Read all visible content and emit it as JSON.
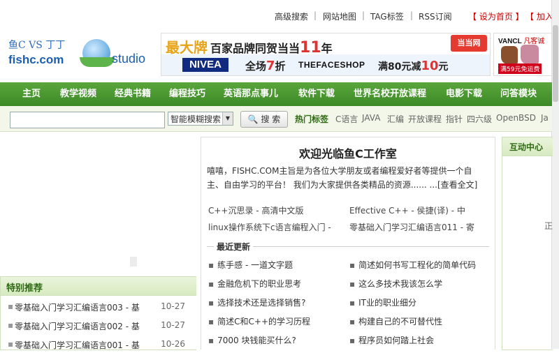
{
  "top_links": {
    "advanced_search": "高级搜索",
    "site_map": "网站地图",
    "tag": "TAG标签",
    "rss": "RSS订阅",
    "sep": "|",
    "set_home": "【 设为首页 】",
    "add_fav": "【 加入"
  },
  "logo": {
    "fish_text": "鱼C VS 丁丁",
    "domain": "fishc.com",
    "studio": "studio"
  },
  "banner": {
    "brand": "最大牌",
    "slogan_prefix": "百家品牌同贺当当",
    "slogan_num": "11",
    "slogan_suffix": "年",
    "dangdang": "当当网",
    "nivea": "NIVEA",
    "offer1_prefix": "全场",
    "offer1_num": "7",
    "offer1_suffix": "折",
    "faceshop": "THEFACESHOP",
    "offer2_prefix": "满80元减",
    "offer2_num": "10",
    "offer2_suffix": "元"
  },
  "side_ad": {
    "brand": "VANCL",
    "brand_suffix": "凡客诚",
    "price": "满59元免运费"
  },
  "nav": {
    "items": [
      "主页",
      "教学视频",
      "经典书籍",
      "编程技巧",
      "英语那点事儿",
      "软件下载",
      "世界名校开放课程",
      "电影下载",
      "问答模块"
    ]
  },
  "search": {
    "input_value": "",
    "mode": "智能模糊搜索",
    "button": "🔍 搜 索",
    "hot_label": "热门标签",
    "tags": [
      "C语言",
      "JAVA",
      "汇编",
      "开放课程",
      "指针",
      "四六级",
      "OpenBSD",
      "Ja"
    ]
  },
  "special": {
    "header": "特别推荐",
    "items": [
      {
        "title": "零基础入门学习汇编语言003 - 基",
        "date": "10-27"
      },
      {
        "title": "零基础入门学习汇编语言002 - 基",
        "date": "10-27"
      },
      {
        "title": "零基础入门学习汇编语言001 - 基",
        "date": "10-26"
      }
    ]
  },
  "center": {
    "title": "欢迎光临鱼C工作室",
    "intro": "嘻嘻，FISHC.COM主旨是为各位大学朋友或者编程爱好者等提供一个自主、自由学习的平台！ 我们为大家提供各类精品的资源...... ...",
    "more": "[查看全文]",
    "links": [
      "C++沉思录 - 高清中文版",
      "Effective C++ - 侯捷(译) - 中",
      "linux操作系统下c语言编程入门 -",
      "零基础入门学习汇编语言011 - 寄"
    ],
    "latest_label": "最近更新",
    "news_left": [
      "练手感 - 一道文字题",
      "金融危机下的职业思考",
      "选择技术还是选择销售?",
      "简述C和C++的学习历程",
      "7000 块钱能买什么?"
    ],
    "news_right": [
      "简述如何书写工程化的简单代码",
      "这么多技术我该怎么学",
      "IT业的职业细分",
      "构建自己的不可替代性",
      "程序员如何踏上社会"
    ]
  },
  "right": {
    "header": "互动中心",
    "stub": "正"
  }
}
